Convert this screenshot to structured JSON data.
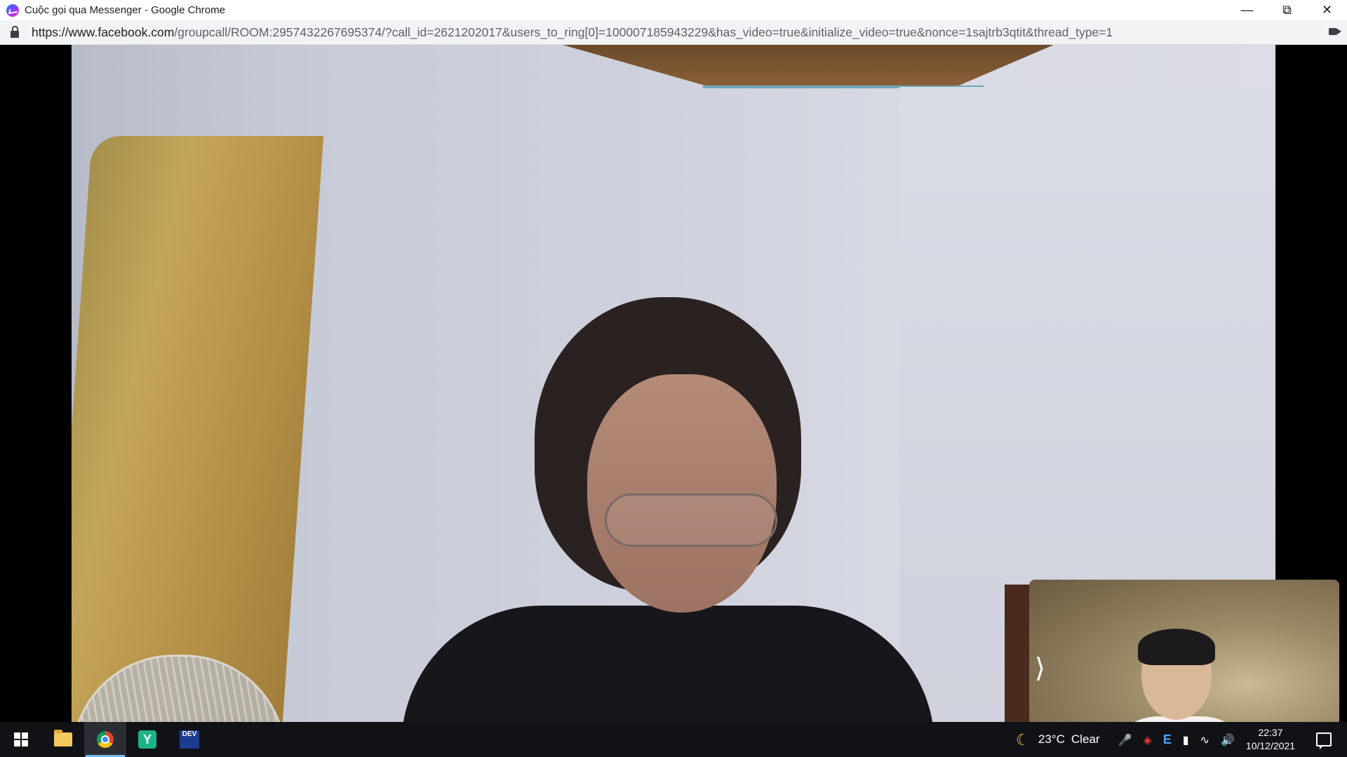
{
  "window": {
    "title": "Cuộc gọi qua Messenger - Google Chrome"
  },
  "address": {
    "host": "https://www.facebook.com",
    "path": "/groupcall/ROOM:2957432267695374/?call_id=2621202017&users_to_ring[0]=100007185943229&has_video=true&initialize_video=true&nonce=1sajtrb3qtit&thread_type=1"
  },
  "taskbar": {
    "items": [
      {
        "name": "start",
        "icon": "windows-logo"
      },
      {
        "name": "file-explorer",
        "icon": "folder-icon"
      },
      {
        "name": "chrome",
        "icon": "chrome-icon",
        "active": true
      },
      {
        "name": "app-y",
        "icon": "y-app-icon",
        "glyph": "Y"
      },
      {
        "name": "dev",
        "icon": "dev-app-icon",
        "glyph": "DEV"
      }
    ],
    "weather": {
      "temp": "23°C",
      "condition": "Clear"
    },
    "tray_e": "E",
    "clock": {
      "time": "22:37",
      "date": "10/12/2021"
    }
  },
  "call": {
    "self_view_toggle": "⟩"
  },
  "colors": {
    "taskbar": "#101216",
    "accent": "#76b9ed",
    "titlebar": "#ffffff",
    "addressbar": "#f1f3f4"
  }
}
